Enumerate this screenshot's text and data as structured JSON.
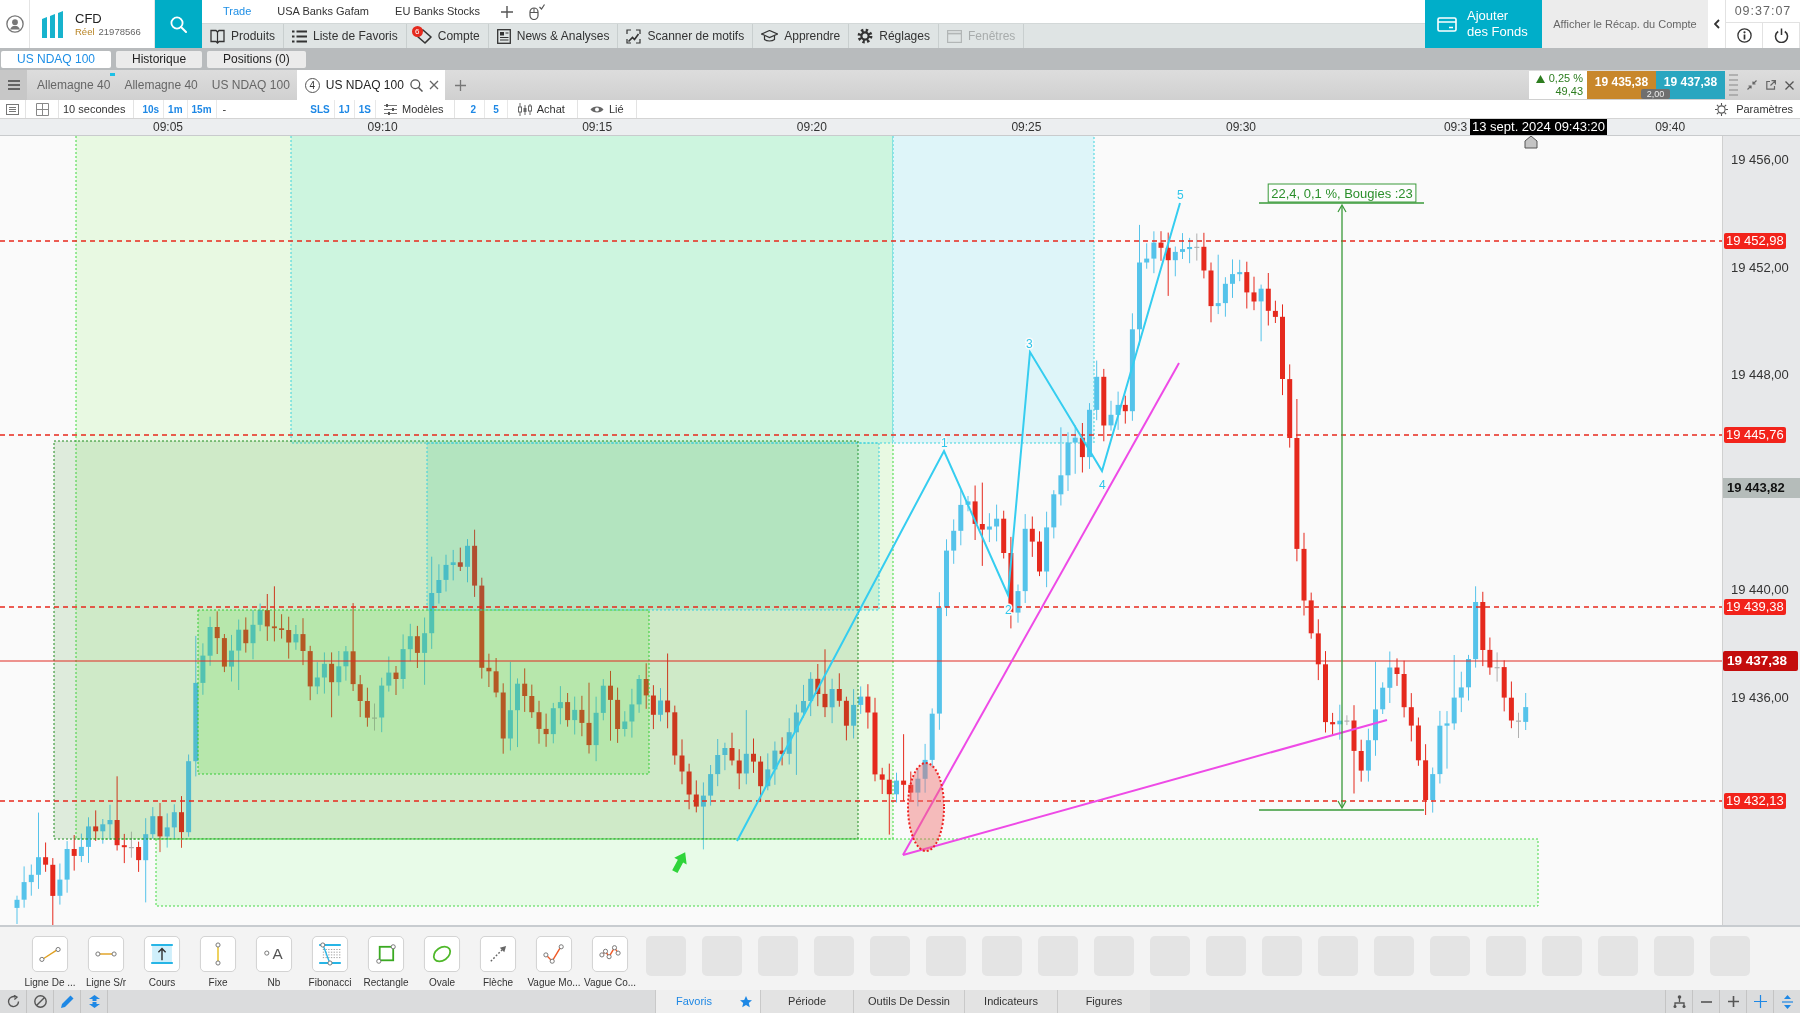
{
  "header": {
    "account": {
      "product": "CFD",
      "mode": "Réel",
      "number": "21978566"
    },
    "watchlists": [
      {
        "label": "Trade",
        "selected": true
      },
      {
        "label": "USA Banks Gafam",
        "selected": false
      },
      {
        "label": "EU Banks Stocks",
        "selected": false
      }
    ],
    "menu": [
      {
        "label": "Produits",
        "kind": "products",
        "disabled": false
      },
      {
        "label": "Liste de Favoris",
        "kind": "watchlist",
        "disabled": false
      },
      {
        "label": "Compte",
        "kind": "account",
        "disabled": false,
        "badge": "6"
      },
      {
        "label": "News & Analyses",
        "kind": "news",
        "disabled": false
      },
      {
        "label": "Scanner de motifs",
        "kind": "scanner",
        "disabled": false
      },
      {
        "label": "Apprendre",
        "kind": "learn",
        "disabled": false
      },
      {
        "label": "Réglages",
        "kind": "settings",
        "disabled": false
      },
      {
        "label": "Fenêtres",
        "kind": "windows",
        "disabled": true
      }
    ],
    "add_funds_button": "Ajouter des Fonds",
    "account_summary_link": "Afficher le Récap. du Compte",
    "clock": "09:37:07"
  },
  "instrument_tabs": [
    {
      "label": "US NDAQ 100",
      "selected": true
    },
    {
      "label": "Historique",
      "selected": false
    },
    {
      "label": "Positions (0)",
      "selected": false
    }
  ],
  "chart_tabs": [
    {
      "label": "Allemagne 40",
      "selected": false,
      "updated": true
    },
    {
      "label": "Allemagne 40",
      "selected": false,
      "updated": false
    },
    {
      "label": "US NDAQ 100",
      "selected": false,
      "updated": false
    },
    {
      "label": "US NDAQ 100",
      "selected": true,
      "updated": false,
      "layout_count": "4"
    }
  ],
  "quote": {
    "rising": true,
    "change_percent": "0,25 %",
    "change_points": "49,43",
    "sell_price": "19 435,38",
    "buy_price": "19 437,38",
    "spread": "2,00"
  },
  "chart_toolbar": {
    "interval": "10 secondes",
    "quick_intervals": [
      "10s",
      "1m",
      "15m"
    ],
    "custom_interval": "-",
    "ranges": [
      "SLS",
      "1J",
      "1S"
    ],
    "templates_button": "Modèles",
    "layout_buttons": [
      "2",
      "5"
    ],
    "order_button": "Achat",
    "link_button": "Lié",
    "settings_button": "Paramètres"
  },
  "chart": {
    "time_axis": {
      "labels": [
        "09:05",
        "09:10",
        "09:15",
        "09:20",
        "09:25",
        "09:30",
        "09:3",
        "09:40"
      ],
      "crosshair_time": "13 sept. 2024 09:43:20"
    },
    "price_axis": {
      "labels": [
        "19 456,00",
        "19 452,00",
        "19 448,00",
        "19 440,00",
        "19 436,00"
      ],
      "crosshair_price": "19 443,82"
    },
    "levels": [
      {
        "price": "19 452,98",
        "kind": "alert"
      },
      {
        "price": "19 445,76",
        "kind": "alert"
      },
      {
        "price": "19 439,38",
        "kind": "alert"
      },
      {
        "price": "19 437,38",
        "kind": "current"
      },
      {
        "price": "19 432,13",
        "kind": "alert"
      }
    ],
    "wave_labels": [
      "1",
      "2",
      "3",
      "4",
      "5"
    ],
    "measure_label": "22,4, 0,1 %, Bougies :23"
  },
  "drawing_tools": [
    {
      "label": "Ligne De ...",
      "kind": "trendline"
    },
    {
      "label": "Ligne S/r",
      "kind": "hline"
    },
    {
      "label": "Cours",
      "kind": "price"
    },
    {
      "label": "Fixe",
      "kind": "vline"
    },
    {
      "label": "Nb",
      "kind": "text",
      "icon_text": "A"
    },
    {
      "label": "Fibonacci",
      "kind": "fibonacci"
    },
    {
      "label": "Rectangle",
      "kind": "rectangle"
    },
    {
      "label": "Ovale",
      "kind": "ellipse"
    },
    {
      "label": "Flèche",
      "kind": "arrow"
    },
    {
      "label": "Vague Mo...",
      "kind": "wave_impulse"
    },
    {
      "label": "Vague Co...",
      "kind": "wave_corrective"
    }
  ],
  "bottom_tabs": [
    {
      "label": "Favoris",
      "selected": true,
      "starred": true
    },
    {
      "label": "Période",
      "selected": false,
      "starred": false
    },
    {
      "label": "Outils De Dessin",
      "selected": false,
      "starred": false
    },
    {
      "label": "Indicateurs",
      "selected": false,
      "starred": false
    },
    {
      "label": "Figures",
      "selected": false,
      "starred": false
    }
  ]
}
